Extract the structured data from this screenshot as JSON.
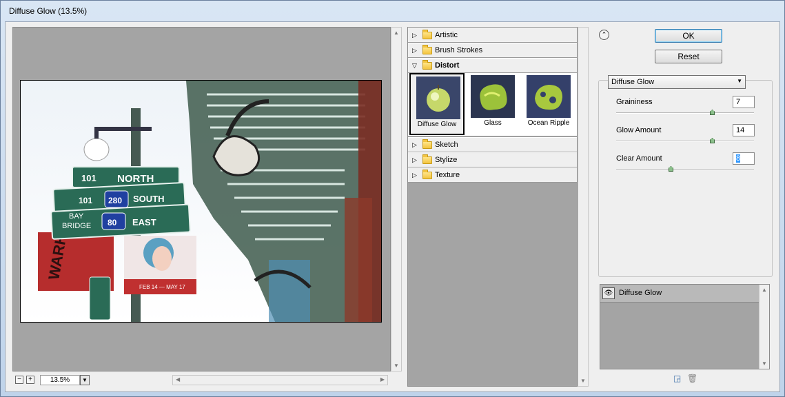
{
  "window": {
    "title": "Diffuse Glow (13.5%)"
  },
  "preview": {
    "zoom": "13.5%",
    "zoom_out_label": "−",
    "zoom_in_label": "+",
    "sign": {
      "row1_shield": "101",
      "row1_dir": "NORTH",
      "row2_shield": "101",
      "row2_shield2": "280",
      "row2_dir": "SOUTH",
      "row3_dest_a": "BAY",
      "row3_dest_b": "BRIDGE",
      "row3_shield": "80",
      "row3_dir": "EAST"
    },
    "banner_text": "WARHOL",
    "poster_text": "FEB 14 — MAY 17"
  },
  "gallery": {
    "categories": [
      {
        "label": "Artistic",
        "open": false
      },
      {
        "label": "Brush Strokes",
        "open": false
      },
      {
        "label": "Distort",
        "open": true
      },
      {
        "label": "Sketch",
        "open": false
      },
      {
        "label": "Stylize",
        "open": false
      },
      {
        "label": "Texture",
        "open": false
      }
    ],
    "thumbs": [
      {
        "label": "Diffuse Glow",
        "selected": true
      },
      {
        "label": "Glass",
        "selected": false
      },
      {
        "label": "Ocean Ripple",
        "selected": false
      }
    ]
  },
  "buttons": {
    "ok": "OK",
    "reset": "Reset"
  },
  "settings": {
    "filter_select": "Diffuse Glow",
    "params": [
      {
        "label": "Graininess",
        "value": "7",
        "level": 0.73
      },
      {
        "label": "Glow Amount",
        "value": "14",
        "level": 0.73
      },
      {
        "label": "Clear Amount",
        "value": "8",
        "level": 0.43
      }
    ]
  },
  "layers": {
    "items": [
      {
        "label": "Diffuse Glow"
      }
    ]
  }
}
